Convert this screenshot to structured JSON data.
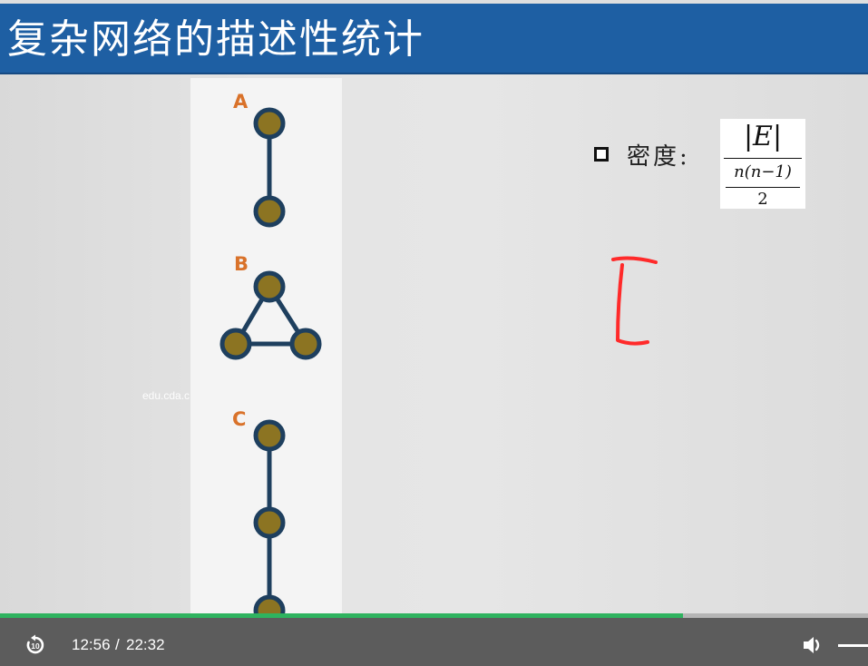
{
  "slide": {
    "title": "复杂网络的描述性统计",
    "watermark": "edu.cda.c",
    "figures": [
      {
        "label": "A"
      },
      {
        "label": "B"
      },
      {
        "label": "C"
      }
    ],
    "density": {
      "label": "密度:",
      "formula": {
        "numerator": "|E|",
        "denominator_top": "n(n−1)",
        "denominator_bottom": "2"
      }
    }
  },
  "colors": {
    "title_bar": "#1e5fa3",
    "node_fill": "#8c7422",
    "node_stroke": "#1e3f5e",
    "edge": "#1e3f5e",
    "letter": "#d9722a",
    "annotation": "#ff2a2a",
    "progress": "#2fb35f"
  },
  "player": {
    "replay_icon": "replay-10-icon",
    "current_time": "12:56",
    "separator": "/",
    "duration": "22:32",
    "progress_fraction": 0.787,
    "volume_icon": "speaker-icon"
  }
}
